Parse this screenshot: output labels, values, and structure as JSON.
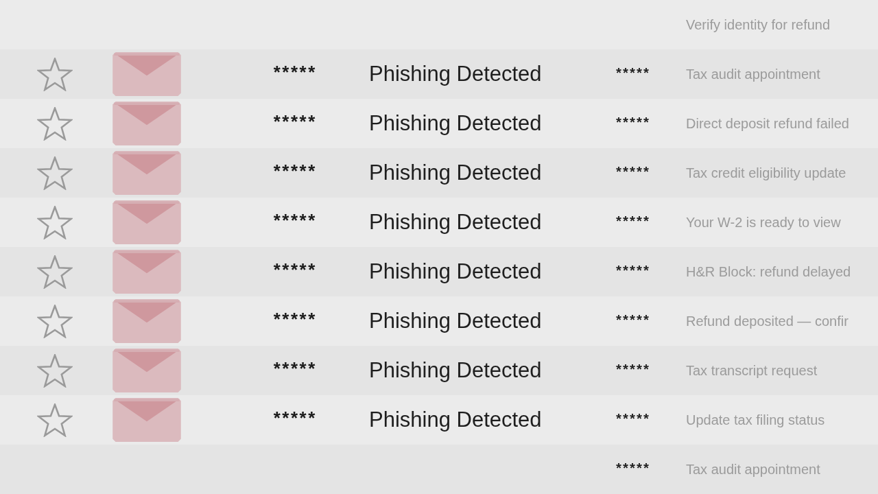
{
  "inbox": {
    "rows": [
      {
        "subject": "Verify identity for refund"
      },
      {
        "starred": false,
        "sender": "*****",
        "status": "Phishing Detected",
        "date": "*****",
        "subject": "Tax audit appointment"
      },
      {
        "starred": false,
        "sender": "*****",
        "status": "Phishing Detected",
        "date": "*****",
        "subject": "Direct deposit refund failed"
      },
      {
        "starred": false,
        "sender": "*****",
        "status": "Phishing Detected",
        "date": "*****",
        "subject": "Tax credit eligibility update"
      },
      {
        "starred": false,
        "sender": "*****",
        "status": "Phishing Detected",
        "date": "*****",
        "subject": "Your W-2 is ready to view"
      },
      {
        "starred": false,
        "sender": "*****",
        "status": "Phishing Detected",
        "date": "*****",
        "subject": "H&R Block: refund delayed"
      },
      {
        "starred": false,
        "sender": "*****",
        "status": "Phishing Detected",
        "date": "*****",
        "subject": "Refund deposited — confir"
      },
      {
        "starred": false,
        "sender": "*****",
        "status": "Phishing Detected",
        "date": "*****",
        "subject": "Tax transcript request"
      },
      {
        "starred": false,
        "sender": "*****",
        "status": "Phishing Detected",
        "date": "*****",
        "subject": "Update tax filing status"
      },
      {
        "date": "*****",
        "subject": "Tax audit appointment"
      }
    ]
  }
}
